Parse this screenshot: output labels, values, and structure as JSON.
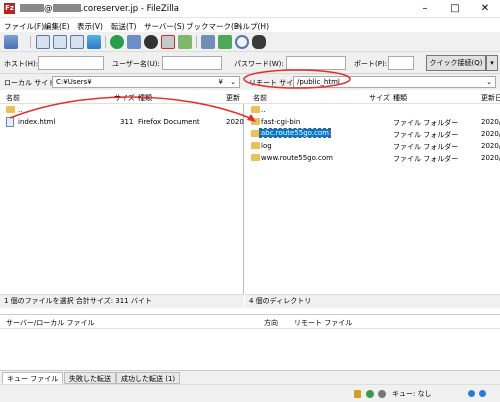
{
  "window": {
    "title_suffix": ".coreserver.jp - FileZilla",
    "title_at": "@",
    "logo_icon": "filezilla-logo-icon"
  },
  "menu": [
    "ファイル(F)",
    "編集(E)",
    "表示(V)",
    "転送(T)",
    "サーバー(S)",
    "ブックマーク(B)",
    "ヘルプ(H)"
  ],
  "quickconnect": {
    "host_label": "ホスト(H):",
    "user_label": "ユーザー名(U):",
    "pass_label": "パスワード(W):",
    "port_label": "ポート(P):",
    "connect_label": "クイック接続(Q)"
  },
  "local": {
    "path_label": "ローカル サイト:",
    "path_value": "C:¥Users¥",
    "path_suffix": "¥",
    "cols": {
      "name": "名前",
      "size": "サイズ",
      "type": "種類",
      "modified": "更新"
    },
    "rows": [
      {
        "name": "..",
        "size": "",
        "type": "",
        "date": "",
        "icon": "folder-icon"
      },
      {
        "name": "index.html",
        "size": "311",
        "type": "Firefox Document",
        "date": "2020",
        "icon": "html-file-icon"
      }
    ],
    "status": "1 個のファイルを選択 合計サイズ: 311 バイト"
  },
  "remote": {
    "path_label": "リモート サイト:",
    "path_value": "/public_html",
    "cols": {
      "name": "名前",
      "size": "サイズ",
      "type": "種類",
      "modified": "更新日"
    },
    "rows": [
      {
        "name": "..",
        "type": "",
        "date": ""
      },
      {
        "name": "fast-cgi-bin",
        "type": "ファイル フォルダー",
        "date": "2020/"
      },
      {
        "name": "abc.route55go.com",
        "type": "ファイル フォルダー",
        "date": "2020/"
      },
      {
        "name": "log",
        "type": "ファイル フォルダー",
        "date": "2020/"
      },
      {
        "name": "www.route55go.com",
        "type": "ファイル フォルダー",
        "date": "2020/"
      }
    ],
    "selected_row": "abc.route55go.com",
    "status": "4 個のディレクトリ"
  },
  "queue": {
    "cols": {
      "server": "サーバー/ローカル ファイル",
      "direction": "方向",
      "remote": "リモート ファイル"
    },
    "tabs": [
      "キュー ファイル",
      "失敗した転送",
      "成功した転送 (1)"
    ]
  },
  "statusbar": {
    "queue_text": "キュー: なし"
  },
  "colors": {
    "highlight": "#e0302a",
    "selection": "#0078d7",
    "folder": "#e8c15a"
  }
}
